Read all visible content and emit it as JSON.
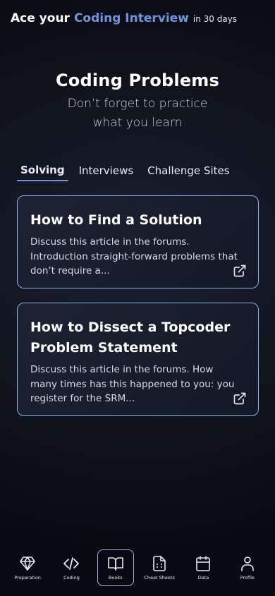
{
  "header": {
    "prefix": "Ace your",
    "highlight": "Coding Interview",
    "suffix": "in 30 days",
    "accent_color": "#6e95dd"
  },
  "hero": {
    "title": "Coding Problems",
    "subtitle_line1": "Don’t forget to practice",
    "subtitle_line2": "what you learn"
  },
  "tabs": [
    {
      "label": "Solving",
      "active": true
    },
    {
      "label": "Interviews",
      "active": false
    },
    {
      "label": "Challenge Sites",
      "active": false
    }
  ],
  "articles": [
    {
      "title": "How to Find a Solution",
      "excerpt": "Discuss this article in the forums. Introduction straight-forward problems that don’t require a...",
      "icon": "external-link-icon"
    },
    {
      "title": "How to Dissect a Topcoder Problem Statement",
      "excerpt": "Discuss this article in the forums. How many times has this happened to you: you register for the SRM...",
      "icon": "external-link-icon"
    }
  ],
  "bottom_nav": [
    {
      "label": "Preparation",
      "icon": "diamond-icon",
      "active": false
    },
    {
      "label": "Coding",
      "icon": "code-icon",
      "active": false
    },
    {
      "label": "Books",
      "icon": "book-icon",
      "active": true
    },
    {
      "label": "Cheat Sheets",
      "icon": "document-icon",
      "active": false
    },
    {
      "label": "Data",
      "icon": "calendar-icon",
      "active": false
    },
    {
      "label": "Profile",
      "icon": "user-icon",
      "active": false
    }
  ]
}
